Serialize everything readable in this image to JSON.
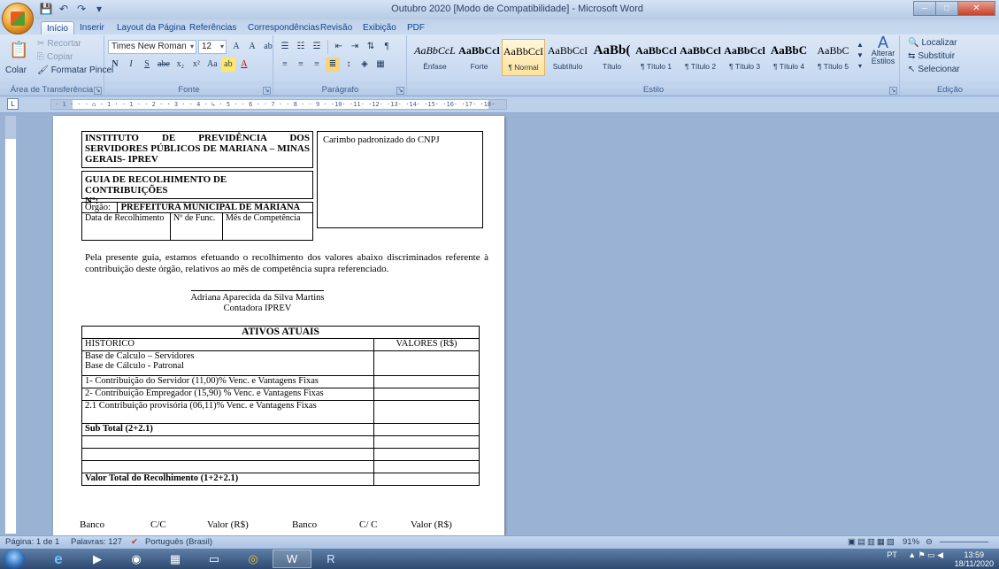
{
  "window": {
    "title": "Outubro 2020 [Modo de Compatibilidade] - Microsoft Word",
    "min": "–",
    "max": "□",
    "close": "✕"
  },
  "qat": [
    "💾",
    "↶",
    "↷",
    "▾"
  ],
  "tabs": [
    "Início",
    "Inserir",
    "Layout da Página",
    "Referências",
    "Correspondências",
    "Revisão",
    "Exibição",
    "PDF"
  ],
  "clipboard": {
    "paste": "Colar",
    "cut": "Recortar",
    "copy": "Copiar",
    "format_painter": "Formatar Pincel",
    "label": "Área de Transferência"
  },
  "font": {
    "name": "Times New Roman",
    "size": "12",
    "row1": [
      "A",
      "A",
      "Aa",
      "ab"
    ],
    "row2": [
      "N",
      "I",
      "S",
      "abe",
      "x₂",
      "x²",
      "Aa",
      "ab",
      "A"
    ],
    "label": "Fonte"
  },
  "paragraph": {
    "label": "Parágrafo"
  },
  "styles": {
    "label": "Estilo",
    "items": [
      {
        "preview": "AaBbCcL",
        "name": "Ênfase"
      },
      {
        "preview": "AaBbCcl",
        "name": "Forte"
      },
      {
        "preview": "AaBbCcI",
        "name": "¶ Normal"
      },
      {
        "preview": "AaBbCcI",
        "name": "Subtítulo"
      },
      {
        "preview": "AaBb(",
        "name": "Título"
      },
      {
        "preview": "AaBbCcl",
        "name": "¶ Título 1"
      },
      {
        "preview": "AaBbCcl",
        "name": "¶ Título 2"
      },
      {
        "preview": "AaBbCcl",
        "name": "¶ Título 3"
      },
      {
        "preview": "AaBbC",
        "name": "¶ Título 4"
      },
      {
        "preview": "AaBbC",
        "name": "¶ Título 5"
      }
    ],
    "change": "Alterar Estilos"
  },
  "editing": {
    "label": "Edição",
    "find": "Localizar",
    "replace": "Substituir",
    "select": "Selecionar"
  },
  "ruler": {
    "marks": "· 1 · · · ⌂ · 1 · · 1 · · 2 · · 3 · · 4 · ↳ · 5 · · 6 · · 7 · · 8 · · 9 · ·10· ·11· ·12· ·13· ·14· ·15· ·16· ·17· ·18·"
  },
  "document": {
    "institute": "INSTITUTO DE PREVIDÊNCIA DOS SERVIDORES PÚBLICOS DE MARIANA – MINAS GERAIS- IPREV",
    "stamp_label": "Carimbo padronizado do CNPJ",
    "guide_title": "GUIA DE RECOLHIMENTO DE CONTRIBUIÇÕES",
    "guide_no": "Nº:",
    "organ_label": "Órgão:",
    "organ_value": "PREFEITURA MUNICIPAL DE MARIANA",
    "date_label": "Data de Recolhimento",
    "func_label": "Nº de Func.",
    "month_label": "Mês de Competência",
    "paragraph": "Pela presente guia, estamos efetuando o recolhimento dos valores abaixo discriminados referente à contribuição deste órgão, relativos ao mês de competência supra referenciado.",
    "signer_name": "Adriana Aparecida da Silva Martins",
    "signer_role": "Contadora IPREV",
    "table": {
      "title": "ATIVOS ATUAIS",
      "col_hist": "HISTÓRICO",
      "col_val": "VALORES (R$)",
      "base1": "Base de Calculo – Servidores",
      "base2": "Base de Cálculo - Patronal",
      "row1": "1- Contribuição do Servidor (11,00)% Venc. e Vantagens Fixas",
      "row2": "2- Contribuição Empregador (15,90) % Venc. e Vantagens Fixas",
      "row3": "2.1 Contribuição provisória (06,11)% Venc. e Vantagens Fixas",
      "subtotal": "Sub Total (2+2.1)",
      "total": "Valor Total do Recolhimento (1+2+2.1)"
    },
    "footer": [
      "Banco",
      "C/C",
      "Valor (R$)",
      "Banco",
      "C/ C",
      "Valor (R$)"
    ]
  },
  "status": {
    "page": "Página: 1 de 1",
    "words": "Palavras: 127",
    "lang": "Português (Brasil)",
    "zoom": "91%"
  },
  "tray": {
    "lang": "PT",
    "time": "13:59",
    "date": "18/11/2020"
  }
}
